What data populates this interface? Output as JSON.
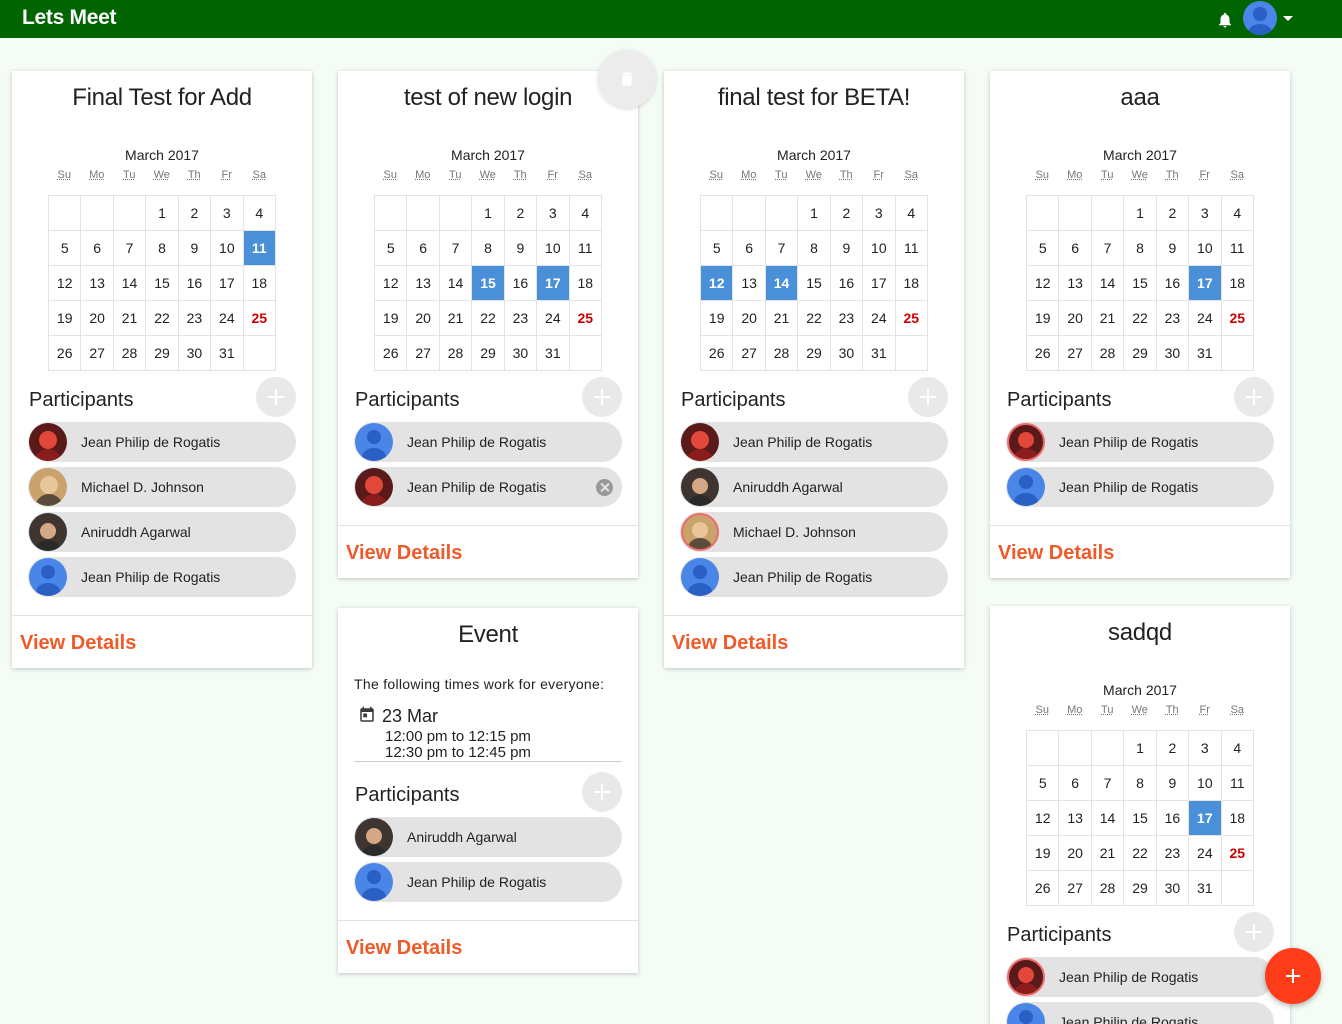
{
  "app": {
    "title": "Lets Meet"
  },
  "header": {
    "bell_icon": "bell-icon",
    "avatar_icon": "user-avatar",
    "menu_icon": "caret-down-icon"
  },
  "common": {
    "month": "March 2017",
    "weekdays": [
      "Su",
      "Mo",
      "Tu",
      "We",
      "Th",
      "Fr",
      "Sa"
    ],
    "participants_label": "Participants",
    "view_details_label": "View Details",
    "accent_color": "#f05a28",
    "brand_color": "#006400",
    "selected_color": "#4a90d9"
  },
  "cards": [
    {
      "title": "Final Test for Add",
      "selected_days": [
        11
      ],
      "participants": [
        "Jean Philip de Rogatis",
        "Michael D. Johnson",
        "Aniruddh Agarwal",
        "Jean Philip de Rogatis"
      ]
    },
    {
      "title": "test of new login",
      "selected_days": [
        15,
        17
      ],
      "participants": [
        "Jean Philip de Rogatis",
        "Jean Philip de Rogatis"
      ]
    },
    {
      "title": "final test for BETA!",
      "selected_days": [
        12,
        14
      ],
      "participants": [
        "Jean Philip de Rogatis",
        "Aniruddh Agarwal",
        "Michael D. Johnson",
        "Jean Philip de Rogatis"
      ]
    },
    {
      "title": "aaa",
      "selected_days": [
        17
      ],
      "participants": [
        "Jean Philip de Rogatis",
        "Jean Philip de Rogatis"
      ]
    },
    {
      "title": "sadqd",
      "selected_days": [
        17
      ],
      "participants": [
        "Jean Philip de Rogatis",
        "Jean Philip de Rogatis"
      ]
    }
  ],
  "event_card": {
    "title": "Event",
    "description": "The following times work for everyone:",
    "date": "23 Mar",
    "times": [
      "12:00 pm to 12:15 pm",
      "12:30 pm to 12:45 pm"
    ],
    "participants": [
      "Aniruddh Agarwal",
      "Jean Philip de Rogatis"
    ]
  },
  "fab": {
    "label": "+"
  }
}
